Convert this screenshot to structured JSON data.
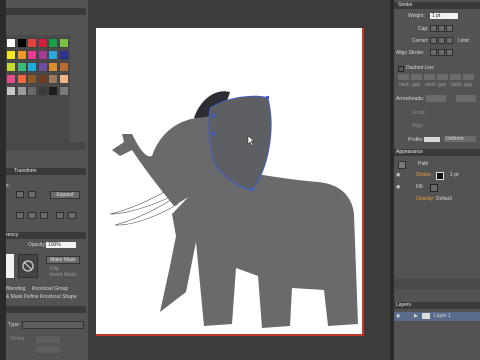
{
  "colors": {
    "ui_panel": "#535353",
    "canvas_bg": "#3c3c3c",
    "artboard": "#ffffff",
    "artboard_border": "#c0392b",
    "elephant_gray": "#6a6a6d",
    "ear_gray": "#5e5f63",
    "selection_blue": "#3b5bdb",
    "layer_highlight": "#5a6b8c"
  },
  "swatches": {
    "rows": [
      [
        "#ffffff",
        "#000000",
        "#e8403a",
        "#d41f3c",
        "#13a44a",
        "#7cc242"
      ],
      [
        "#f5ea1f",
        "#f09a28",
        "#e83a8f",
        "#a43d93",
        "#2aa9e0",
        "#2e3192"
      ],
      [
        "#c8d933",
        "#3cb878",
        "#1eaedb",
        "#6b4da1",
        "#d88e2c",
        "#b86b32"
      ],
      [
        "#e94c8c",
        "#ec6a3e",
        "#8b5a2b",
        "#6e3b1e",
        "#9e7a5a",
        "#f2b58a"
      ],
      [
        "#c8c8c8",
        "#9a9a9a",
        "#6a6a6a",
        "#3a3a3a",
        "#1e1e1e",
        "#7a7a7a"
      ]
    ],
    "patterns": [
      "gradient",
      "white",
      "pattern1",
      "pattern2",
      "pattern3"
    ]
  },
  "transform_panel": {
    "tab": "Transform",
    "label_abbrev": "s:",
    "expand_button": "Expand"
  },
  "transparency_panel": {
    "tab_partial": "rency",
    "opacity_label": "Opacity:",
    "opacity_value": "100%",
    "make_mask": "Make Mask",
    "clip": "Clip",
    "invert_mask": "Invert Mask",
    "isolate_blending": "Blending",
    "knockout_group": "Knockout Group",
    "opacity_mask_text": "& Mask Define Knockout Shape"
  },
  "type_panel": {
    "label": "Type:",
    "sub": "Stroke"
  },
  "stroke_panel": {
    "title": "Stroke",
    "weight_label": "Weight:",
    "weight_value": "1 pt",
    "cap_label": "Cap:",
    "corner_label": "Corner:",
    "limit_label": "Limit:",
    "align_stroke_label": "Align Stroke:",
    "dashed_line_label": "Dashed Line",
    "dash_labels": [
      "dash",
      "gap",
      "dash",
      "gap",
      "dash",
      "gap"
    ],
    "arrowheads_label": "Arrowheads:",
    "scale_label": "Scale:",
    "align_label": "Align:",
    "profile_label": "Profile:",
    "profile_value": "Uniform"
  },
  "appearance_panel": {
    "title": "Appearance",
    "object_label": "Path",
    "rows": [
      {
        "name": "Stroke:",
        "value": "1 pt"
      },
      {
        "name": "Fill:",
        "value": ""
      },
      {
        "name": "Opacity:",
        "value": "Default"
      }
    ]
  },
  "layers_panel": {
    "title": "Layers",
    "layer_name": "Layer 1"
  }
}
